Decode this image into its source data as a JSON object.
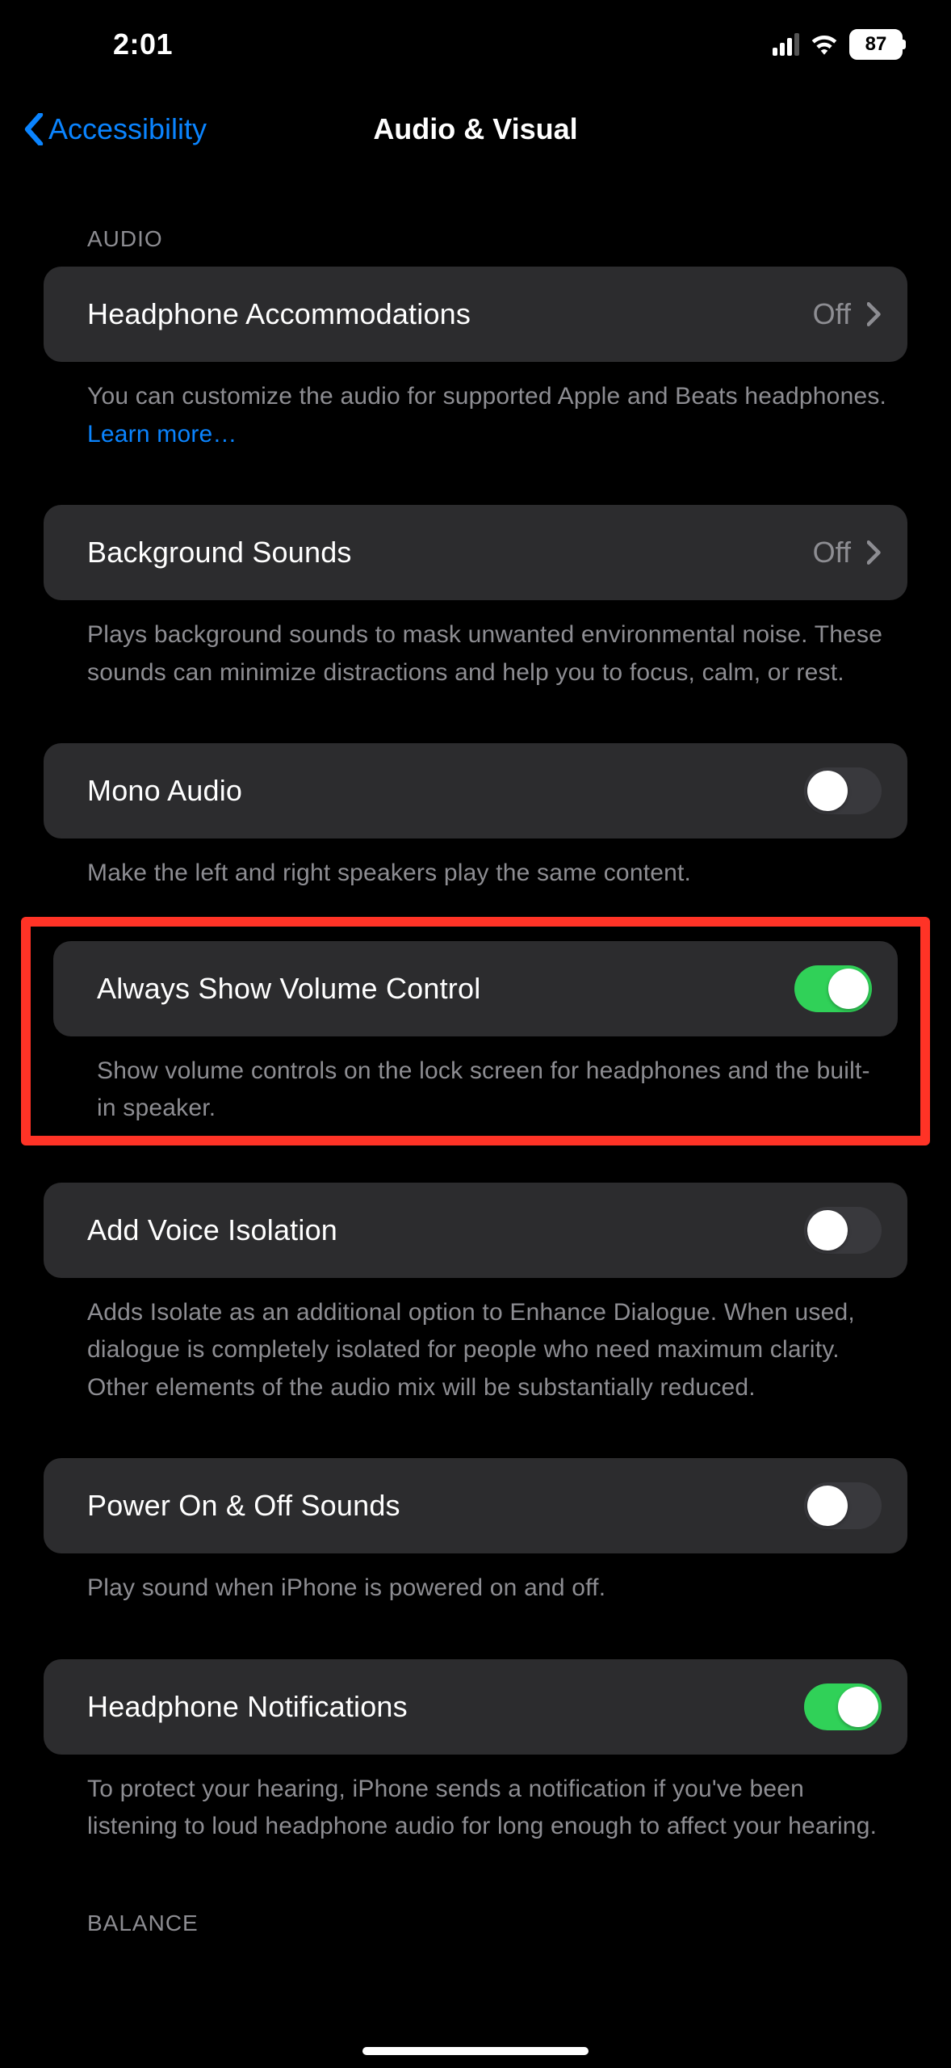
{
  "status": {
    "time": "2:01",
    "battery": "87"
  },
  "nav": {
    "back": "Accessibility",
    "title": "Audio & Visual"
  },
  "sections": {
    "audio_header": "AUDIO",
    "balance_header": "BALANCE"
  },
  "rows": {
    "headphone_accom": {
      "label": "Headphone Accommodations",
      "value": "Off"
    },
    "headphone_accom_footer": "You can customize the audio for supported Apple and Beats headphones. ",
    "learn_more": "Learn more…",
    "background_sounds": {
      "label": "Background Sounds",
      "value": "Off"
    },
    "background_sounds_footer": "Plays background sounds to mask unwanted environmental noise. These sounds can minimize distractions and help you to focus, calm, or rest.",
    "mono_audio": {
      "label": "Mono Audio"
    },
    "mono_audio_footer": "Make the left and right speakers play the same content.",
    "always_show_volume": {
      "label": "Always Show Volume Control"
    },
    "always_show_volume_footer": "Show volume controls on the lock screen for headphones and the built-in speaker.",
    "add_voice_isolation": {
      "label": "Add Voice Isolation"
    },
    "add_voice_isolation_footer": "Adds Isolate as an additional option to Enhance Dialogue. When used, dialogue is completely isolated for people who need maximum clarity. Other elements of the audio mix will be substantially reduced.",
    "power_sounds": {
      "label": "Power On & Off Sounds"
    },
    "power_sounds_footer": "Play sound when iPhone is powered on and off.",
    "headphone_notifications": {
      "label": "Headphone Notifications"
    },
    "headphone_notifications_footer": "To protect your hearing, iPhone sends a notification if you've been listening to loud headphone audio for long enough to affect your hearing."
  }
}
